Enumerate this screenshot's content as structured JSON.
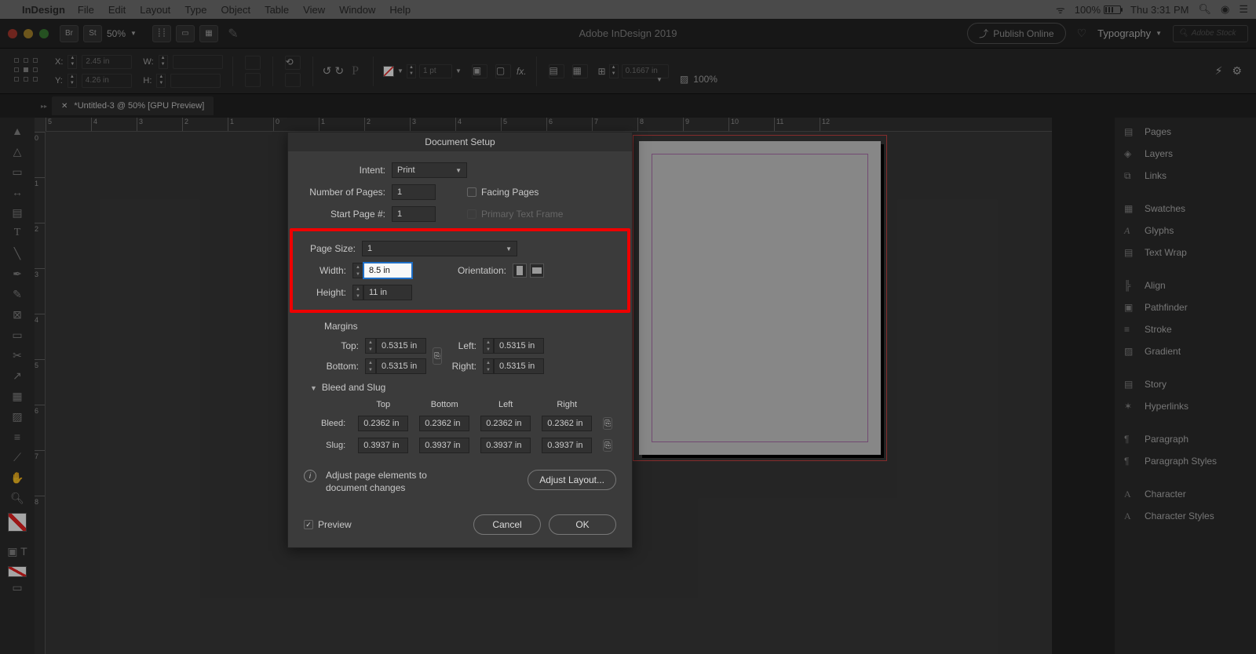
{
  "mac_menu": {
    "app": "InDesign",
    "items": [
      "File",
      "Edit",
      "Layout",
      "Type",
      "Object",
      "Table",
      "View",
      "Window",
      "Help"
    ],
    "battery_pct": "100%",
    "datetime": "Thu 3:31 PM"
  },
  "app_bar": {
    "br_btn": "Br",
    "st_btn": "St",
    "zoom": "50%",
    "title": "Adobe InDesign 2019",
    "publish": "Publish Online",
    "workspace": "Typography",
    "search_placeholder": "Adobe Stock"
  },
  "ctrl_strip": {
    "x_label": "X:",
    "x_value": "2.45 in",
    "y_label": "Y:",
    "y_value": "4.26 in",
    "w_label": "W:",
    "h_label": "H:",
    "stroke_wt": "1 pt",
    "tint_pct": "100%",
    "grid_field": "0.1667 in"
  },
  "doc_tab": {
    "label": "*Untitled-3 @ 50% [GPU Preview]"
  },
  "ruler": {
    "h": [
      "5",
      "4",
      "3",
      "2",
      "1",
      "0",
      "1",
      "2",
      "3",
      "4",
      "5",
      "6",
      "7",
      "8",
      "9",
      "10",
      "11",
      "12"
    ],
    "v": [
      "0",
      "1",
      "2",
      "3",
      "4",
      "5",
      "6",
      "7",
      "8"
    ]
  },
  "right_panels": {
    "items": [
      "Pages",
      "Layers",
      "Links",
      "",
      "Swatches",
      "Glyphs",
      "Text Wrap",
      "",
      "Align",
      "Pathfinder",
      "Stroke",
      "Gradient",
      "",
      "Story",
      "Hyperlinks",
      "",
      "Paragraph",
      "Paragraph Styles",
      "",
      "Character",
      "Character Styles"
    ]
  },
  "dialog": {
    "title": "Document Setup",
    "intent_label": "Intent:",
    "intent_value": "Print",
    "num_pages_label": "Number of Pages:",
    "num_pages_value": "1",
    "start_page_label": "Start Page #:",
    "start_page_value": "1",
    "facing_label": "Facing Pages",
    "primary_label": "Primary Text Frame",
    "page_size_label": "Page Size:",
    "page_size_value": "1",
    "width_label": "Width:",
    "width_value": "8.5 in",
    "height_label": "Height:",
    "height_value": "11 in",
    "orientation_label": "Orientation:",
    "margins_title": "Margins",
    "top_label": "Top:",
    "top_value": "0.5315 in",
    "bottom_label": "Bottom:",
    "bottom_value": "0.5315 in",
    "left_label": "Left:",
    "left_value": "0.5315 in",
    "right_label": "Right:",
    "right_value": "0.5315 in",
    "bleed_title": "Bleed and Slug",
    "col_top": "Top",
    "col_bottom": "Bottom",
    "col_left": "Left",
    "col_right": "Right",
    "bleed_label": "Bleed:",
    "bleed_top": "0.2362 in",
    "bleed_bottom": "0.2362 in",
    "bleed_left": "0.2362 in",
    "bleed_right": "0.2362 in",
    "slug_label": "Slug:",
    "slug_top": "0.3937 in",
    "slug_bottom": "0.3937 in",
    "slug_left": "0.3937 in",
    "slug_right": "0.3937 in",
    "adjust_text": "Adjust page elements to document changes",
    "adjust_btn": "Adjust Layout...",
    "preview_label": "Preview",
    "cancel": "Cancel",
    "ok": "OK"
  }
}
